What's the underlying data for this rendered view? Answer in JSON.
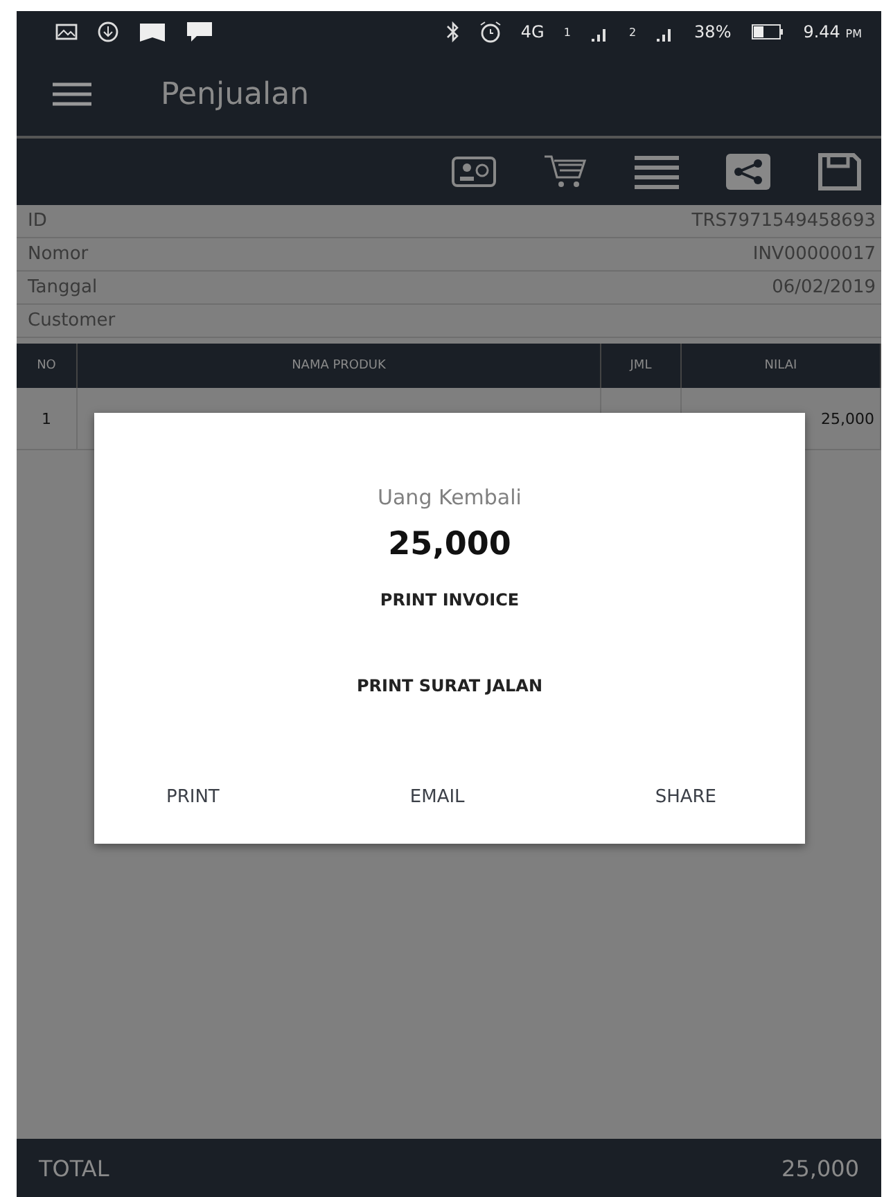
{
  "status_bar": {
    "network": "4G",
    "sim_1": "1",
    "sim_2": "2",
    "battery": "38%",
    "time": "9.44",
    "time_suffix": "PM"
  },
  "app_bar": {
    "title": "Penjualan"
  },
  "info": [
    {
      "label": "ID",
      "value": "TRS7971549458693"
    },
    {
      "label": "Nomor",
      "value": "INV00000017"
    },
    {
      "label": "Tanggal",
      "value": "06/02/2019"
    },
    {
      "label": "Customer"
    }
  ],
  "table": {
    "columns": [
      "NO",
      "NAMA PRODUK",
      "JML",
      "NILAI"
    ],
    "rows": [
      {
        "no": "1",
        "value": "25,000"
      }
    ]
  },
  "dialog": {
    "caption": "Uang Kembali",
    "amount": "25,000",
    "options": [
      "PRINT INVOICE",
      "PRINT SURAT JALAN"
    ],
    "buttons": [
      "PRINT",
      "EMAIL",
      "SHARE"
    ]
  },
  "footer": {
    "label": "TOTAL",
    "value": "25,000"
  }
}
